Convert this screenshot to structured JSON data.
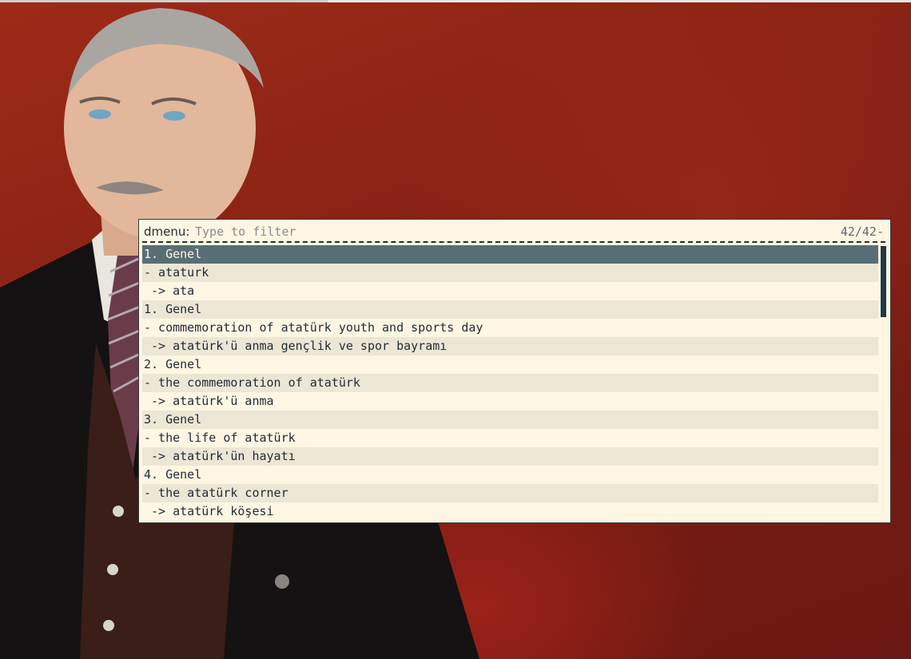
{
  "prompt": {
    "label": "dmenu:",
    "placeholder": "Type to filter",
    "value": "",
    "counter": "42/42-"
  },
  "items": [
    {
      "text": "1. Genel",
      "selected": true
    },
    {
      "text": "- ataturk"
    },
    {
      "text": " -> ata"
    },
    {
      "text": "1. Genel"
    },
    {
      "text": "- commemoration of atatürk youth and sports day"
    },
    {
      "text": " -> atatürk'ü anma gençlik ve spor bayramı"
    },
    {
      "text": "2. Genel"
    },
    {
      "text": "- the commemoration of atatürk"
    },
    {
      "text": " -> atatürk'ü anma"
    },
    {
      "text": "3. Genel"
    },
    {
      "text": "- the life of atatürk"
    },
    {
      "text": " -> atatürk'ün hayatı"
    },
    {
      "text": "4. Genel"
    },
    {
      "text": "- the atatürk corner"
    },
    {
      "text": " -> atatürk köşesi"
    }
  ],
  "colors": {
    "menu_background": "#fdf6e3",
    "alt_row": "#ece6d5",
    "selected_row": "#586e75",
    "scrollbar": "#1e3a44",
    "wallpaper": "#8a2316"
  }
}
